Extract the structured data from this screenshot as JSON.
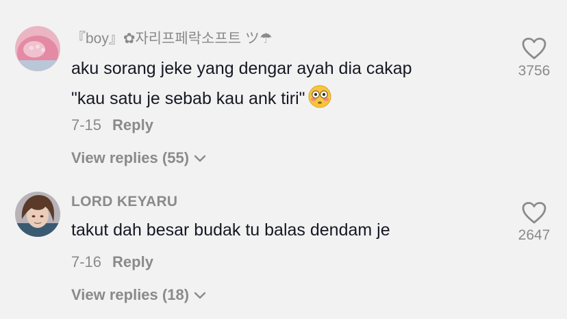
{
  "comments": [
    {
      "username": "『boy』✿자리프페락소프트 ツ☂",
      "text_line1": "aku sorang jeke yang dengar ayah dia cakap",
      "text_line2": "\"kau satu je sebab kau ank tiri\"",
      "emoji_icon": "flushed-face-icon",
      "date": "7-15",
      "reply_label": "Reply",
      "view_replies_label": "View replies (55)",
      "like_count": "3756",
      "avatar_color": "#e6a1b3"
    },
    {
      "username": "LORD KEYARU",
      "text_line1": "takut dah besar budak tu balas dendam je",
      "date": "7-16",
      "reply_label": "Reply",
      "view_replies_label": "View replies (18)",
      "like_count": "2647",
      "avatar_color": "#5b4a3f"
    }
  ],
  "colors": {
    "background": "#f2f2f2",
    "primary_text": "#161823",
    "secondary_text": "#8a8a8a"
  }
}
